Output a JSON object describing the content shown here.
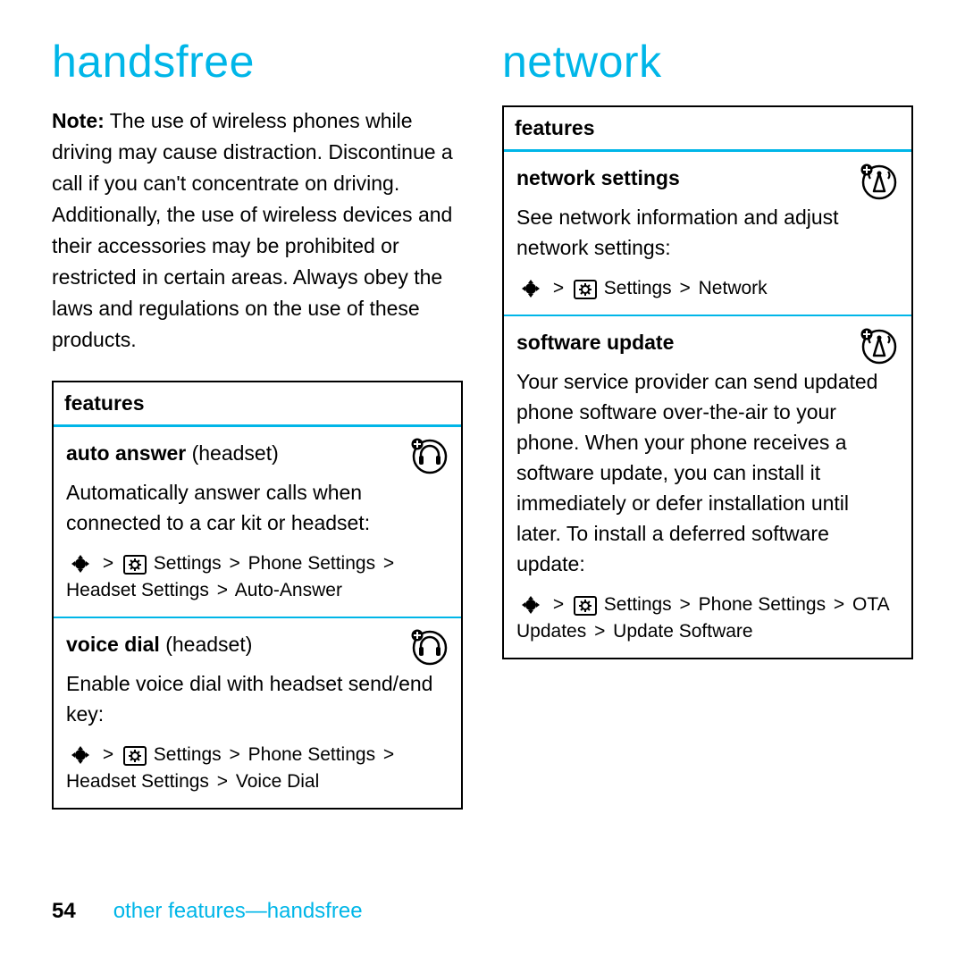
{
  "left": {
    "heading": "handsfree",
    "noteLabel": "Note:",
    "noteText": " The use of wireless phones while driving may cause distraction. Discontinue a call if you can't concentrate on driving. Additionally, the use of wireless devices and their accessories may be prohibited or restricted in certain areas. Always obey the laws and regulations on the use of these products.",
    "tableHeader": "features",
    "row1": {
      "title": "auto answer",
      "suffix": " (headset)",
      "desc": "Automatically answer calls when connected to a car kit or headset:",
      "path1": "Settings",
      "path2": "Phone Settings",
      "path3": "Headset Settings",
      "path4": "Auto-Answer"
    },
    "row2": {
      "title": "voice dial",
      "suffix": " (headset)",
      "desc": "Enable voice dial with headset send/end key:",
      "path1": "Settings",
      "path2": "Phone Settings",
      "path3": "Headset Settings",
      "path4": "Voice Dial"
    }
  },
  "right": {
    "heading": "network",
    "tableHeader": "features",
    "row1": {
      "title": "network settings",
      "desc": "See network information and adjust network settings:",
      "path1": "Settings",
      "path2": "Network"
    },
    "row2": {
      "title": "software update",
      "desc": "Your service provider can send updated phone software over-the-air to your phone. When your phone receives a software update, you can install it immediately or defer installation until later. To install a deferred software update:",
      "path1": "Settings",
      "path2": "Phone Settings",
      "path3": "OTA Updates",
      "path4": "Update Software"
    }
  },
  "footer": {
    "page": "54",
    "section": "other features—handsfree"
  },
  "sep": ">"
}
